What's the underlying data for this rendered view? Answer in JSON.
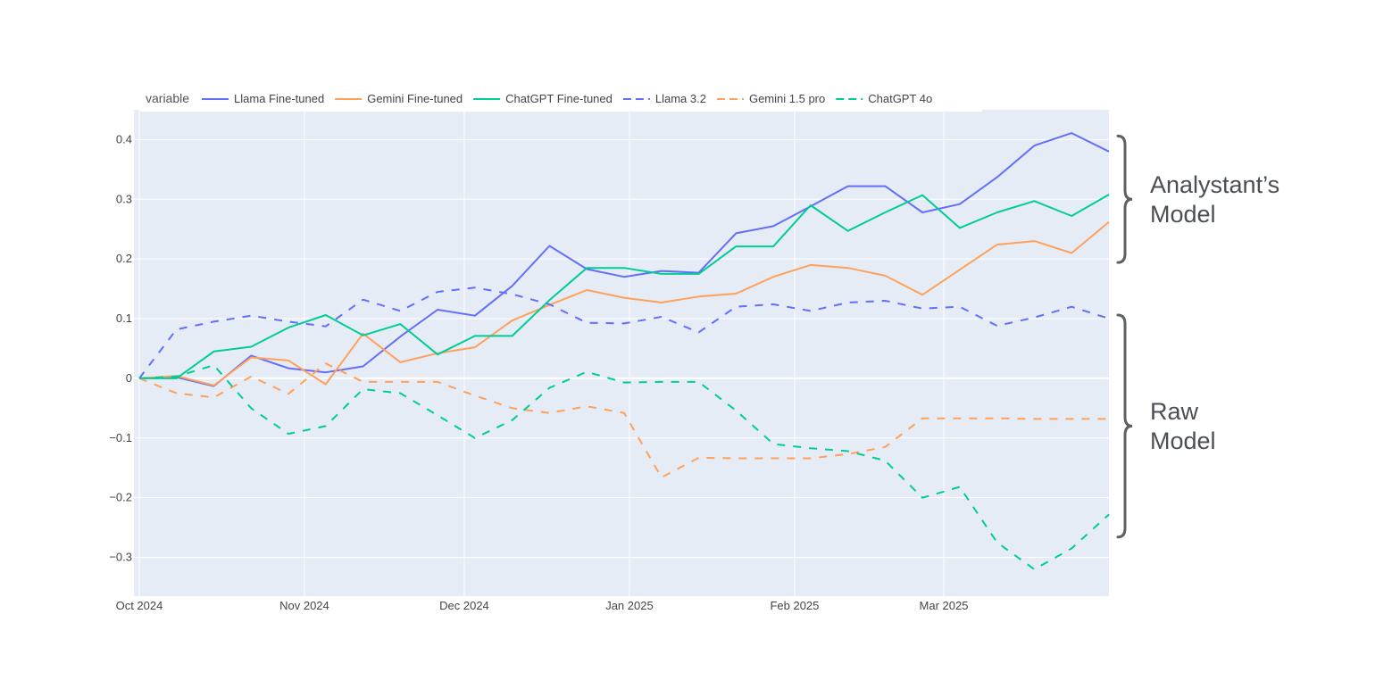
{
  "chart_data": {
    "type": "line",
    "legend": {
      "title": "variable",
      "placement": "top-left"
    },
    "x": [
      "2024-10-01",
      "2024-10-08",
      "2024-10-15",
      "2024-10-22",
      "2024-10-29",
      "2024-11-05",
      "2024-11-12",
      "2024-11-19",
      "2024-11-26",
      "2024-12-03",
      "2024-12-10",
      "2024-12-17",
      "2024-12-24",
      "2024-12-31",
      "2025-01-07",
      "2025-01-14",
      "2025-01-21",
      "2025-01-28",
      "2025-02-04",
      "2025-02-11",
      "2025-02-18",
      "2025-02-25",
      "2025-03-04",
      "2025-03-11",
      "2025-03-18",
      "2025-03-25",
      "2025-04-01"
    ],
    "xlim": [
      "2024-09-30",
      "2025-04-01"
    ],
    "ylim": [
      -0.365,
      0.45
    ],
    "x_ticks": [
      {
        "value": "2024-10-01",
        "label": "Oct 2024"
      },
      {
        "value": "2024-11-01",
        "label": "Nov 2024"
      },
      {
        "value": "2024-12-01",
        "label": "Dec 2024"
      },
      {
        "value": "2025-01-01",
        "label": "Jan 2025"
      },
      {
        "value": "2025-02-01",
        "label": "Feb 2025"
      },
      {
        "value": "2025-03-01",
        "label": "Mar 2025"
      }
    ],
    "y_ticks": [
      {
        "value": 0.4,
        "label": "0.4"
      },
      {
        "value": 0.3,
        "label": "0.3"
      },
      {
        "value": 0.2,
        "label": "0.2"
      },
      {
        "value": 0.1,
        "label": "0.1"
      },
      {
        "value": 0,
        "label": "0"
      },
      {
        "value": -0.1,
        "label": "−0.1"
      },
      {
        "value": -0.2,
        "label": "−0.2"
      },
      {
        "value": -0.3,
        "label": "−0.3"
      }
    ],
    "grid": true,
    "series": [
      {
        "name": "Llama Fine-tuned",
        "color": "#636efa",
        "dash": "solid",
        "values": [
          0,
          0.002,
          -0.013,
          0.038,
          0.017,
          0.01,
          0.02,
          0.07,
          0.115,
          0.105,
          0.155,
          0.222,
          0.183,
          0.17,
          0.18,
          0.177,
          0.243,
          0.255,
          0.288,
          0.322,
          0.322,
          0.278,
          0.292,
          0.337,
          0.39,
          0.411,
          0.38
        ]
      },
      {
        "name": "Gemini Fine-tuned",
        "color": "#ffa15a",
        "dash": "solid",
        "values": [
          0,
          0.004,
          -0.012,
          0.035,
          0.03,
          -0.01,
          0.075,
          0.027,
          0.042,
          0.052,
          0.097,
          0.123,
          0.148,
          0.135,
          0.127,
          0.137,
          0.142,
          0.17,
          0.19,
          0.185,
          0.172,
          0.14,
          0.182,
          0.224,
          0.23,
          0.21,
          0.262
        ]
      },
      {
        "name": "ChatGPT Fine-tuned",
        "color": "#00cc96",
        "dash": "solid",
        "values": [
          0,
          0,
          0.045,
          0.053,
          0.085,
          0.106,
          0.072,
          0.091,
          0.04,
          0.071,
          0.071,
          0.131,
          0.185,
          0.185,
          0.175,
          0.175,
          0.221,
          0.221,
          0.29,
          0.247,
          0.278,
          0.307,
          0.252,
          0.278,
          0.297,
          0.272,
          0.308
        ]
      },
      {
        "name": "Llama 3.2",
        "color": "#636efa",
        "dash": "dashed",
        "values": [
          0,
          0.082,
          0.095,
          0.105,
          0.095,
          0.087,
          0.132,
          0.113,
          0.145,
          0.152,
          0.141,
          0.124,
          0.093,
          0.092,
          0.103,
          0.077,
          0.12,
          0.124,
          0.113,
          0.127,
          0.13,
          0.117,
          0.12,
          0.088,
          0.102,
          0.12,
          0.1
        ]
      },
      {
        "name": "Gemini 1.5 pro",
        "color": "#ffa15a",
        "dash": "dashed",
        "values": [
          0,
          -0.025,
          -0.032,
          0.003,
          -0.026,
          0.025,
          -0.006,
          -0.006,
          -0.006,
          -0.029,
          -0.05,
          -0.058,
          -0.047,
          -0.058,
          -0.166,
          -0.133,
          -0.134,
          -0.134,
          -0.134,
          -0.127,
          -0.115,
          -0.067,
          -0.067,
          -0.067,
          -0.068,
          -0.068,
          -0.068
        ]
      },
      {
        "name": "ChatGPT 4o",
        "color": "#00cc96",
        "dash": "dashed",
        "values": [
          0,
          0.003,
          0.022,
          -0.05,
          -0.093,
          -0.08,
          -0.018,
          -0.025,
          -0.062,
          -0.1,
          -0.07,
          -0.016,
          0.011,
          -0.007,
          -0.006,
          -0.006,
          -0.054,
          -0.11,
          -0.117,
          -0.122,
          -0.138,
          -0.2,
          -0.182,
          -0.275,
          -0.32,
          -0.285,
          -0.228
        ]
      }
    ],
    "annotations": [
      {
        "group": "analyst",
        "lines": [
          "Analystant’s",
          "Model"
        ],
        "y_range": [
          0.2,
          0.4
        ]
      },
      {
        "group": "raw",
        "lines": [
          "Raw",
          "Model"
        ],
        "y_range": [
          -0.26,
          0.1
        ]
      }
    ]
  }
}
